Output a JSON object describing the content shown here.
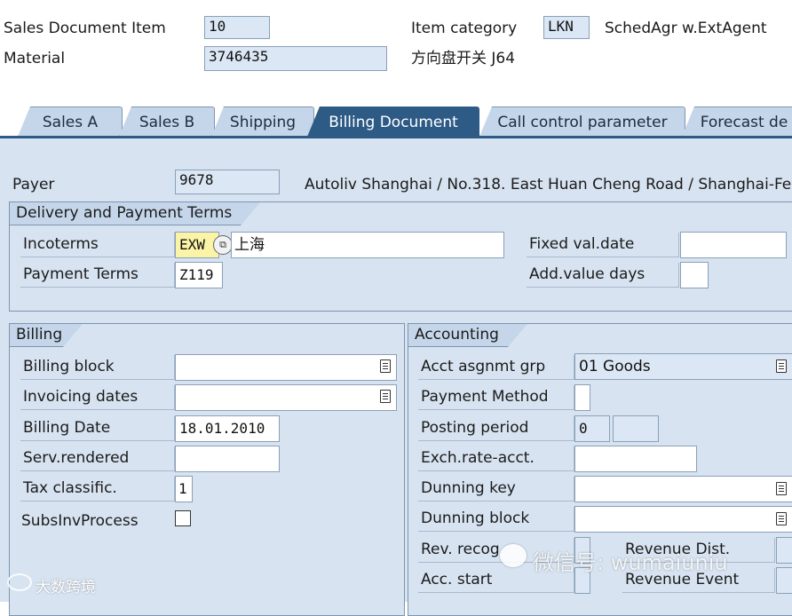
{
  "header": {
    "sales_doc_item_label": "Sales Document Item",
    "sales_doc_item_value": "10",
    "material_label": "Material",
    "material_value": "3746435",
    "item_category_label": "Item category",
    "item_category_value": "LKN",
    "item_category_desc": "SchedAgr w.ExtAgent",
    "material_desc": "方向盘开关 J64"
  },
  "tabs": [
    {
      "label": "Sales A"
    },
    {
      "label": "Sales B"
    },
    {
      "label": "Shipping"
    },
    {
      "label": "Billing Document"
    },
    {
      "label": "Call control parameter"
    },
    {
      "label": "Forecast de"
    }
  ],
  "payer": {
    "label": "Payer",
    "value": "9678",
    "address": "Autoliv Shanghai / No.318. East Huan Cheng Road / Shanghai-Fe"
  },
  "delivery_terms": {
    "title": "Delivery and Payment Terms",
    "incoterms_label": "Incoterms",
    "incoterms_value": "EXW",
    "incoterms2_value": "上海",
    "payment_terms_label": "Payment Terms",
    "payment_terms_value": "Z119",
    "fixed_val_date_label": "Fixed val.date",
    "fixed_val_date_value": "",
    "add_value_days_label": "Add.value days",
    "add_value_days_value": ""
  },
  "billing": {
    "title": "Billing",
    "billing_block_label": "Billing block",
    "billing_block_value": "",
    "invoicing_dates_label": "Invoicing dates",
    "invoicing_dates_value": "",
    "billing_date_label": "Billing Date",
    "billing_date_value": "18.01.2010",
    "serv_rendered_label": "Serv.rendered",
    "serv_rendered_value": "",
    "tax_classific_label": "Tax classific.",
    "tax_classific_value": "1",
    "subs_inv_process_label": "SubsInvProcess",
    "subs_inv_process_checked": false
  },
  "accounting": {
    "title": "Accounting",
    "acct_asgnmt_grp_label": "Acct asgnmt grp",
    "acct_asgnmt_grp_value": "01 Goods",
    "payment_method_label": "Payment Method",
    "payment_method_value": "",
    "posting_period_label": "Posting period",
    "posting_period_value": "0",
    "posting_period_year": "",
    "exch_rate_acct_label": "Exch.rate-acct.",
    "exch_rate_acct_value": "",
    "dunning_key_label": "Dunning key",
    "dunning_key_value": "",
    "dunning_block_label": "Dunning block",
    "dunning_block_value": "",
    "rev_recog_label": "Rev. recog",
    "acc_start_label": "Acc. start",
    "revenue_dist_label": "Revenue Dist.",
    "revenue_event_label": "Revenue Event"
  },
  "watermarks": {
    "left": "大数跨境",
    "right": "微信号: wumaiuniu"
  },
  "colors": {
    "panel_bg": "#d7e3f1",
    "tab_bg": "#c5d6ea",
    "active_tab_bg": "#2e5b86",
    "readonly_field_bg": "#dbe7f5",
    "highlight_field_bg": "#fbf3a6"
  }
}
